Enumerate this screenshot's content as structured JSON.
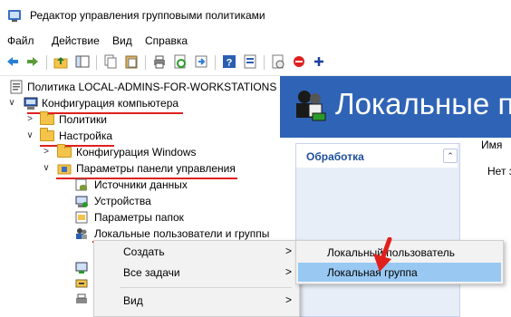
{
  "window": {
    "title": "Редактор управления групповыми политиками"
  },
  "menu": [
    "Файл",
    "Действие",
    "Вид",
    "Справка"
  ],
  "toolbar": {
    "icons": [
      "back-icon",
      "forward-icon",
      "up-folder-icon",
      "show-tree-icon",
      "copy-icon",
      "paste-icon",
      "print-icon",
      "refresh-icon",
      "export-icon",
      "help-icon",
      "properties-icon",
      "new-item-icon",
      "stop-icon",
      "add-icon"
    ]
  },
  "tree": {
    "root": "Политика LOCAL-ADMINS-FOR-WORKSTATIONS [DC",
    "computer_config": "Конфигурация компьютера",
    "policies": "Политики",
    "settings": "Настройка",
    "windows_config": "Конфигурация Windows",
    "control_panel": "Параметры панели управления",
    "data_sources": "Источники данных",
    "devices": "Устройства",
    "folder_options": "Параметры папок",
    "local_users": "Локальные пользователи и группы"
  },
  "right_pane": {
    "banner_title": "Локальные по",
    "actions_title": "Обработка",
    "column_name": "Имя",
    "empty_text": "Нет з"
  },
  "context_menu": {
    "create": "Создать",
    "all_tasks": "Все задачи",
    "view": "Вид"
  },
  "submenu": {
    "local_user": "Локальный пользователь",
    "local_group": "Локальная группа"
  },
  "colors": {
    "accent_blue": "#2f63b6",
    "highlight": "#99c9f2",
    "annotation_red": "#e0201c"
  }
}
